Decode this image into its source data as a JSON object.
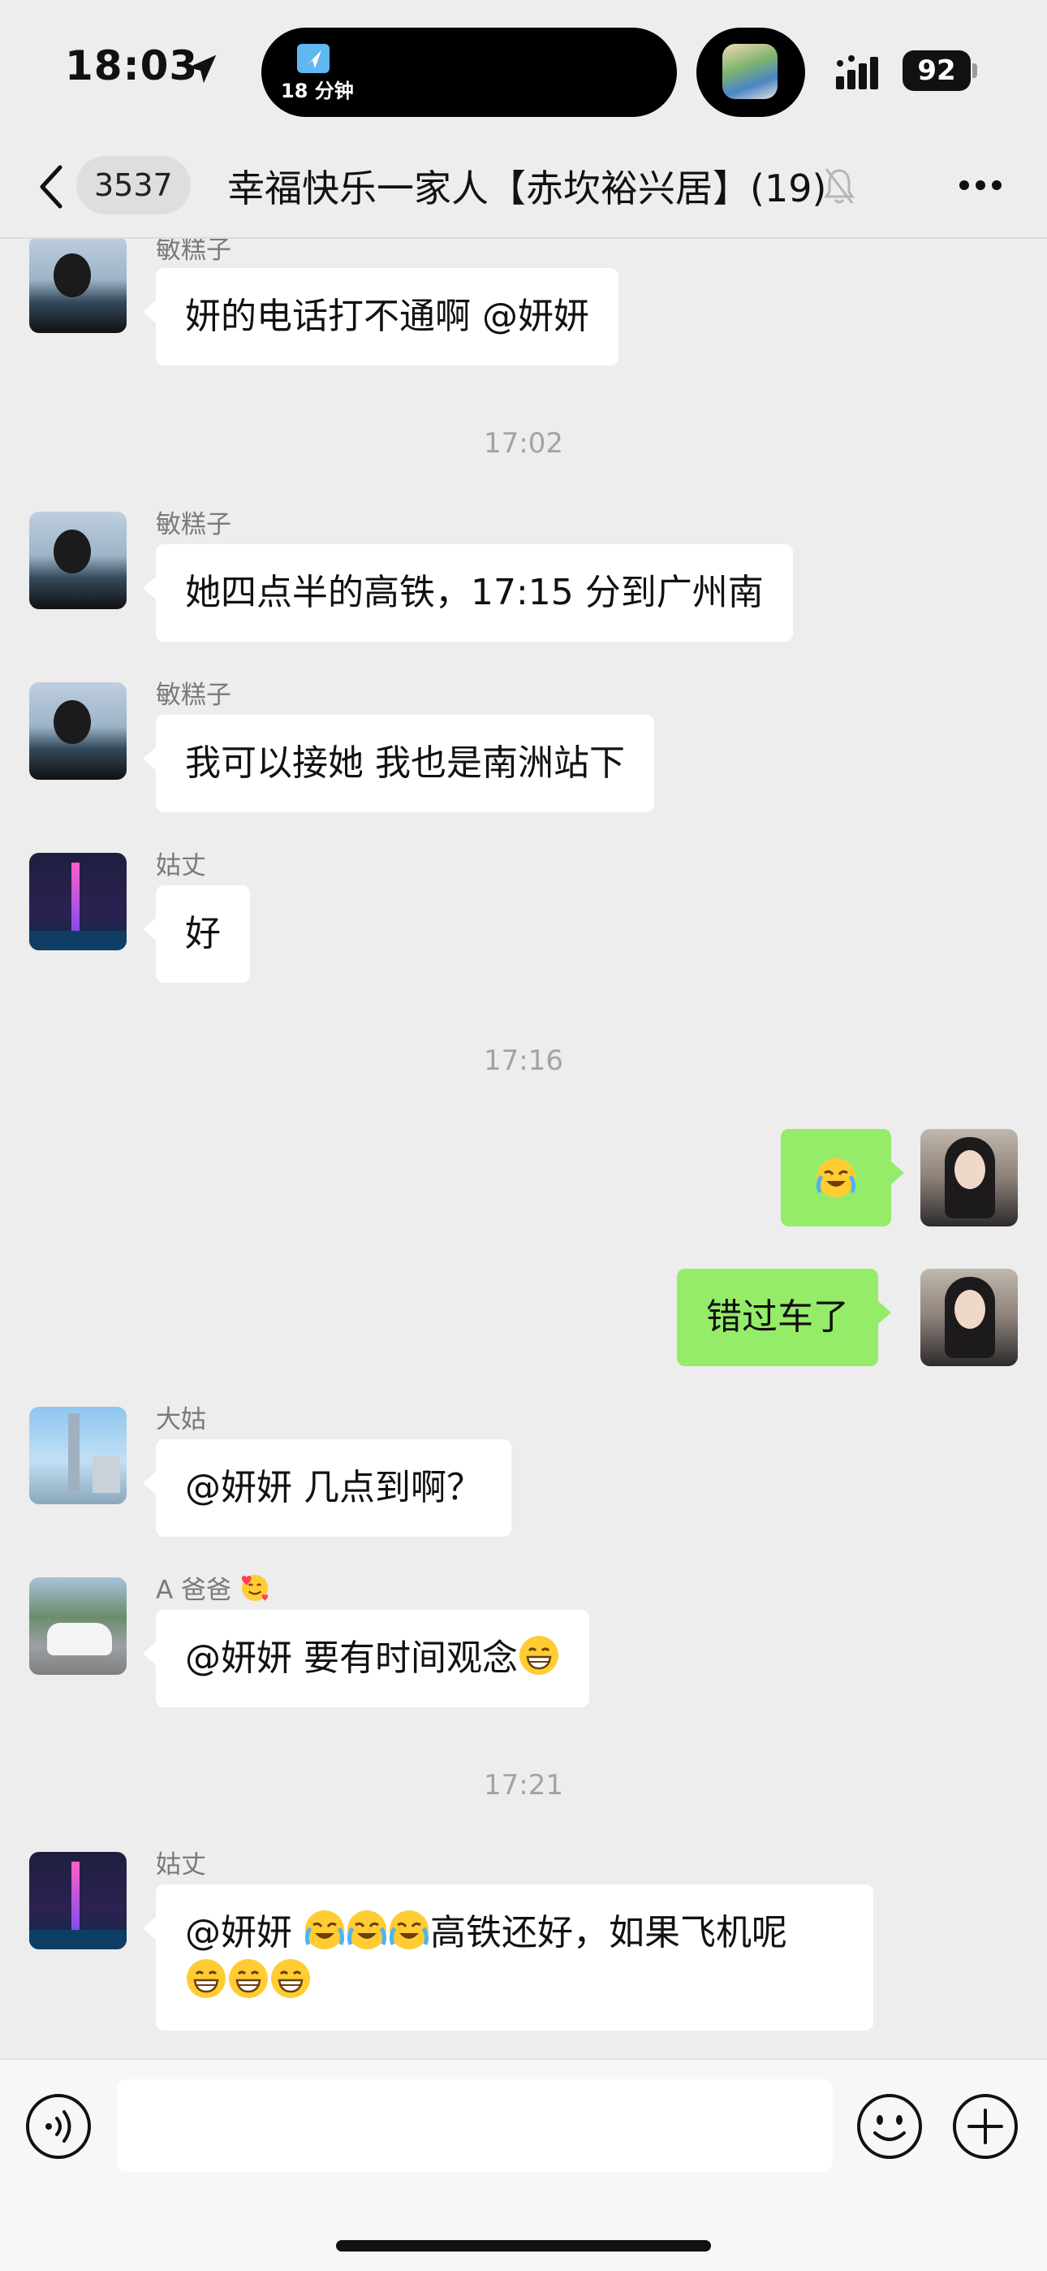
{
  "status_bar": {
    "time": "18:03",
    "island_text": "18 分钟",
    "battery": "92"
  },
  "nav": {
    "unread_count": "3537",
    "title": "幸福快乐一家人【赤坎裕兴居】(19)"
  },
  "messages": [
    {
      "type": "text",
      "side": "left",
      "sender": "敏糕子",
      "avatar": "avatar-min",
      "text": "妍的电话打不通啊 @妍妍"
    },
    {
      "type": "time",
      "text": "17:02"
    },
    {
      "type": "text",
      "side": "left",
      "sender": "敏糕子",
      "avatar": "avatar-min",
      "text": "她四点半的高铁，17:15 分到广州南"
    },
    {
      "type": "text",
      "side": "left",
      "sender": "敏糕子",
      "avatar": "avatar-min",
      "text": "我可以接她 我也是南洲站下"
    },
    {
      "type": "text",
      "side": "left",
      "sender": "姑丈",
      "avatar": "avatar-canton-tower-night",
      "text": "好"
    },
    {
      "type": "time",
      "text": "17:16"
    },
    {
      "type": "emoji",
      "side": "right",
      "avatar": "avatar-self",
      "emoji": "loudly-crying-face"
    },
    {
      "type": "text",
      "side": "right",
      "avatar": "avatar-self",
      "text": "错过车了"
    },
    {
      "type": "text",
      "side": "left",
      "sender": "大姑",
      "avatar": "avatar-canton-tower-day",
      "text": "@妍妍 几点到啊？"
    },
    {
      "type": "text",
      "side": "left",
      "sender": "A 爸爸",
      "sender_emoji": "smiling-face-with-hearts",
      "avatar": "avatar-car",
      "text": "@妍妍 要有时间观念",
      "trailing_emoji": "grinning-face"
    },
    {
      "type": "time",
      "text": "17:21"
    },
    {
      "type": "text",
      "side": "left",
      "sender": "姑丈",
      "avatar": "avatar-canton-tower-night",
      "text_prefix": "@妍妍",
      "prefix_emojis": [
        "loudly-crying-face",
        "loudly-crying-face",
        "loudly-crying-face"
      ],
      "text": "高铁还好，如果飞机呢",
      "trailing_emojis": [
        "grinning-face",
        "grinning-face",
        "grinning-face"
      ]
    }
  ],
  "input_bar": {
    "placeholder": "",
    "left_icon": "voice-icon",
    "right_icons": [
      "emoji-icon",
      "plus-icon"
    ]
  }
}
